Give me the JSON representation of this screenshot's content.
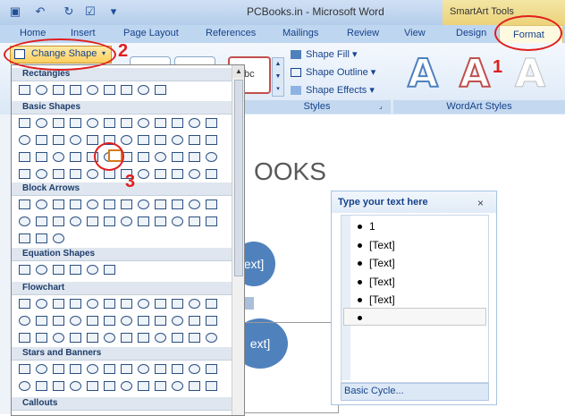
{
  "window": {
    "title": "PCBooks.in - Microsoft Word",
    "context_tab_group": "SmartArt Tools"
  },
  "tabs": [
    "Home",
    "Insert",
    "Page Layout",
    "References",
    "Mailings",
    "Review",
    "View",
    "Design",
    "Format"
  ],
  "ribbon": {
    "change_shape_label": "Change Shape",
    "shape_fill": "Shape Fill",
    "shape_outline": "Shape Outline",
    "shape_effects": "Shape Effects",
    "shape_styles_group": "Styles",
    "wordart_group": "WordArt Styles",
    "shape_preview_text": "bc",
    "wordart_sample": "A"
  },
  "dropdown": {
    "categories": [
      "Rectangles",
      "Basic Shapes",
      "Block Arrows",
      "Equation Shapes",
      "Flowchart",
      "Stars and Banners",
      "Callouts"
    ]
  },
  "document": {
    "heading": "OOKS",
    "node_text": "ext]"
  },
  "text_pane": {
    "title": "Type your text here",
    "close": "×",
    "items": [
      "1",
      "[Text]",
      "[Text]",
      "[Text]",
      "[Text]",
      ""
    ],
    "footer_link": "Basic Cycle..."
  },
  "annotations": [
    "1",
    "2",
    "3"
  ],
  "colors": {
    "accent": "#4f81bd",
    "annotation": "#e01e1e"
  }
}
